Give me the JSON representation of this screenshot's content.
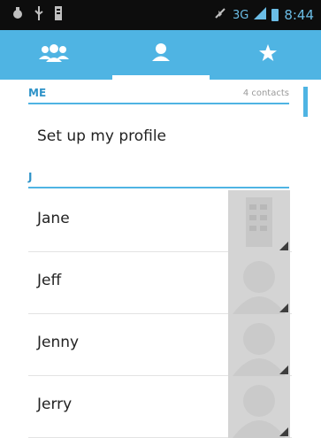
{
  "status_bar": {
    "left_icons": [
      "usb-debug-icon",
      "usb-icon",
      "sd-card-icon"
    ],
    "right_icons": [
      "mute-icon",
      "signal-3g-icon",
      "battery-icon"
    ],
    "network_label": "3G",
    "time": "8:44"
  },
  "tabs": [
    {
      "icon": "groups-icon",
      "selected": false
    },
    {
      "icon": "person-icon",
      "selected": true
    },
    {
      "icon": "star-icon",
      "selected": false
    }
  ],
  "sections": {
    "me": {
      "label": "ME",
      "count": "4 contacts"
    },
    "j": {
      "label": "J"
    }
  },
  "profile_prompt": "Set up my profile",
  "contacts": [
    {
      "name": "Jane",
      "avatar": "contact-photo-icon"
    },
    {
      "name": "Jeff",
      "avatar": "default-avatar-icon"
    },
    {
      "name": "Jenny",
      "avatar": "default-avatar-icon"
    },
    {
      "name": "Jerry",
      "avatar": "default-avatar-icon"
    }
  ],
  "colors": {
    "accent": "#4fb4e3",
    "section_text": "#2f93c8",
    "status_bar": "#0d0d0d",
    "avatar_bg": "#d4d4d4"
  }
}
